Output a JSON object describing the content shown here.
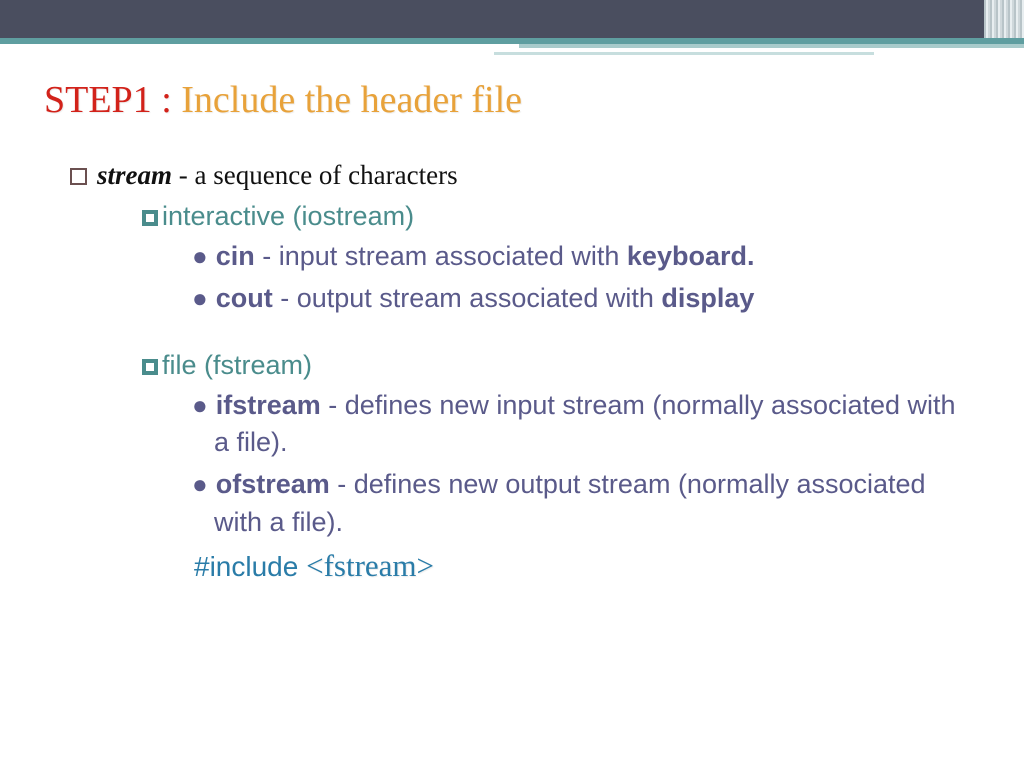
{
  "title": {
    "prefix": "STEP1 : ",
    "rest": "Include the header file"
  },
  "bullet1": {
    "term": "stream",
    "desc": " - a sequence of characters"
  },
  "section1_label": "interactive (iostream)",
  "cin": {
    "name": "cin",
    "desc": " - input stream associated with ",
    "tail": "keyboard."
  },
  "cout": {
    "name": "cout",
    "desc": " - output stream associated with ",
    "tail": "display"
  },
  "section2_label": "file (fstream)",
  "ifstream": {
    "name": "ifstream",
    "desc": " - defines new input stream (normally associated with a file)."
  },
  "ofstream": {
    "name": "ofstream",
    "desc": " - defines new output stream (normally associated with a file)."
  },
  "include": {
    "keyword": "#include ",
    "arg": "<fstream>"
  }
}
